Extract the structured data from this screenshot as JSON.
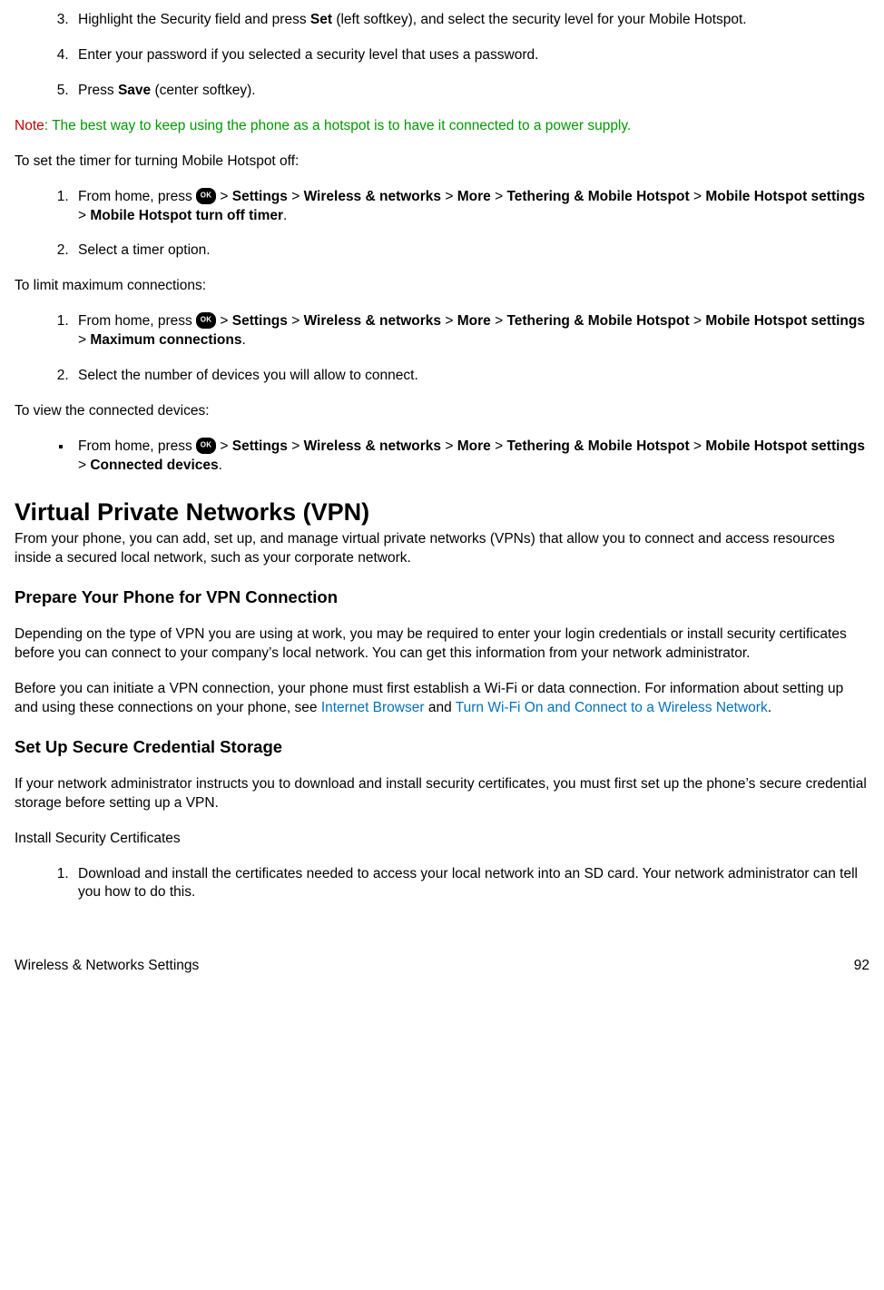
{
  "list1": {
    "start": 3,
    "items": [
      {
        "pre": "Highlight the Security field and press ",
        "b1": "Set",
        "post": " (left softkey), and select the security level for your Mobile Hotspot."
      },
      {
        "text": "Enter your password if you selected a security level that uses a password."
      },
      {
        "pre": "Press ",
        "b1": "Save",
        "post": " (center softkey)."
      }
    ]
  },
  "note": {
    "label": "Note",
    "body": ": The best way to keep using the phone as a hotspot is to have it connected to a power supply."
  },
  "intro_timer": "To set the timer for turning Mobile Hotspot off:",
  "nav_path": {
    "lead": "From home, press ",
    "sep": " > ",
    "s1": "Settings",
    "s2": "Wireless & networks",
    "s3": "More",
    "s4": "Tethering & Mobile Hotspot",
    "s5": "Mobile Hotspot settings",
    "turn_off": "Mobile Hotspot turn off timer",
    "max_conn": "Maximum connections",
    "conn_dev": "Connected devices",
    "period": "."
  },
  "step_timer2": "Select a timer option.",
  "intro_max": "To limit maximum connections:",
  "step_max2": "Select the number of devices you will allow to connect.",
  "intro_view": "To view the connected devices:",
  "vpn": {
    "h1": "Virtual Private Networks (VPN)",
    "p1": "From your phone, you can add, set up, and manage virtual private networks (VPNs) that allow you to connect and access resources inside a secured local network, such as your corporate network.",
    "h2a": "Prepare Your Phone for VPN Connection",
    "p2": "Depending on the type of VPN you are using at work, you may be required to enter your login credentials or install security certificates before you can connect to your company’s local network. You can get this information from your network administrator.",
    "p3_pre": "Before you can initiate a VPN connection, your phone must first establish a Wi-Fi or data connection. For information about setting up and using these connections on your phone, see ",
    "p3_link1": "Internet Browser",
    "p3_mid": " and ",
    "p3_link2": "Turn Wi-Fi On and Connect to a Wireless Network",
    "p3_post": ".",
    "h2b": "Set Up Secure Credential Storage",
    "p4": "If your network administrator instructs you to download and install security certificates, you must first set up the phone’s secure credential storage before setting up a VPN.",
    "p5": "Install Security Certificates",
    "step_cert1": "Download and install the certificates needed to access your local network into an SD card. Your network administrator can tell you how to do this."
  },
  "footer": {
    "left": "Wireless & Networks Settings",
    "right": "92"
  }
}
